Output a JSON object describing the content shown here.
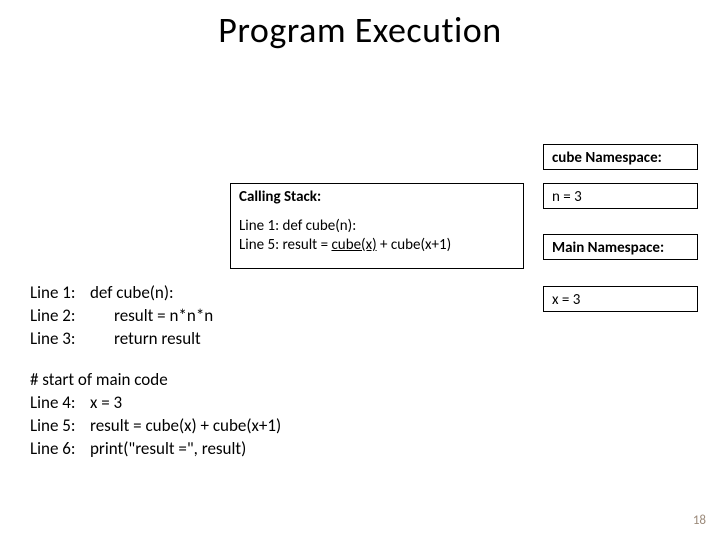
{
  "title": "Program Execution",
  "callingStack": {
    "header": "Calling Stack:",
    "line1": "Line 1: def cube(n):",
    "line2_pre": "Line 5: result = ",
    "line2_call": "cube(x)",
    "line2_post": " + cube(x+1)"
  },
  "cubeNs": {
    "label": "cube Namespace:",
    "value": "n = 3"
  },
  "mainNs": {
    "label": "Main Namespace:",
    "value": "x = 3"
  },
  "code": {
    "l1": {
      "label": "Line 1:",
      "text": "def cube(n):"
    },
    "l2": {
      "label": "Line 2:",
      "text": "result = n*n*n"
    },
    "l3": {
      "label": "Line 3:",
      "text": "return result"
    },
    "comment": "# start of main code",
    "l4": {
      "label": "Line 4:",
      "text": "x = 3"
    },
    "l5": {
      "label": "Line 5:",
      "text": "result = cube(x) + cube(x+1)"
    },
    "l6": {
      "label": "Line 6:",
      "text": "print(\"result =\", result)"
    }
  },
  "pageNumber": "18"
}
